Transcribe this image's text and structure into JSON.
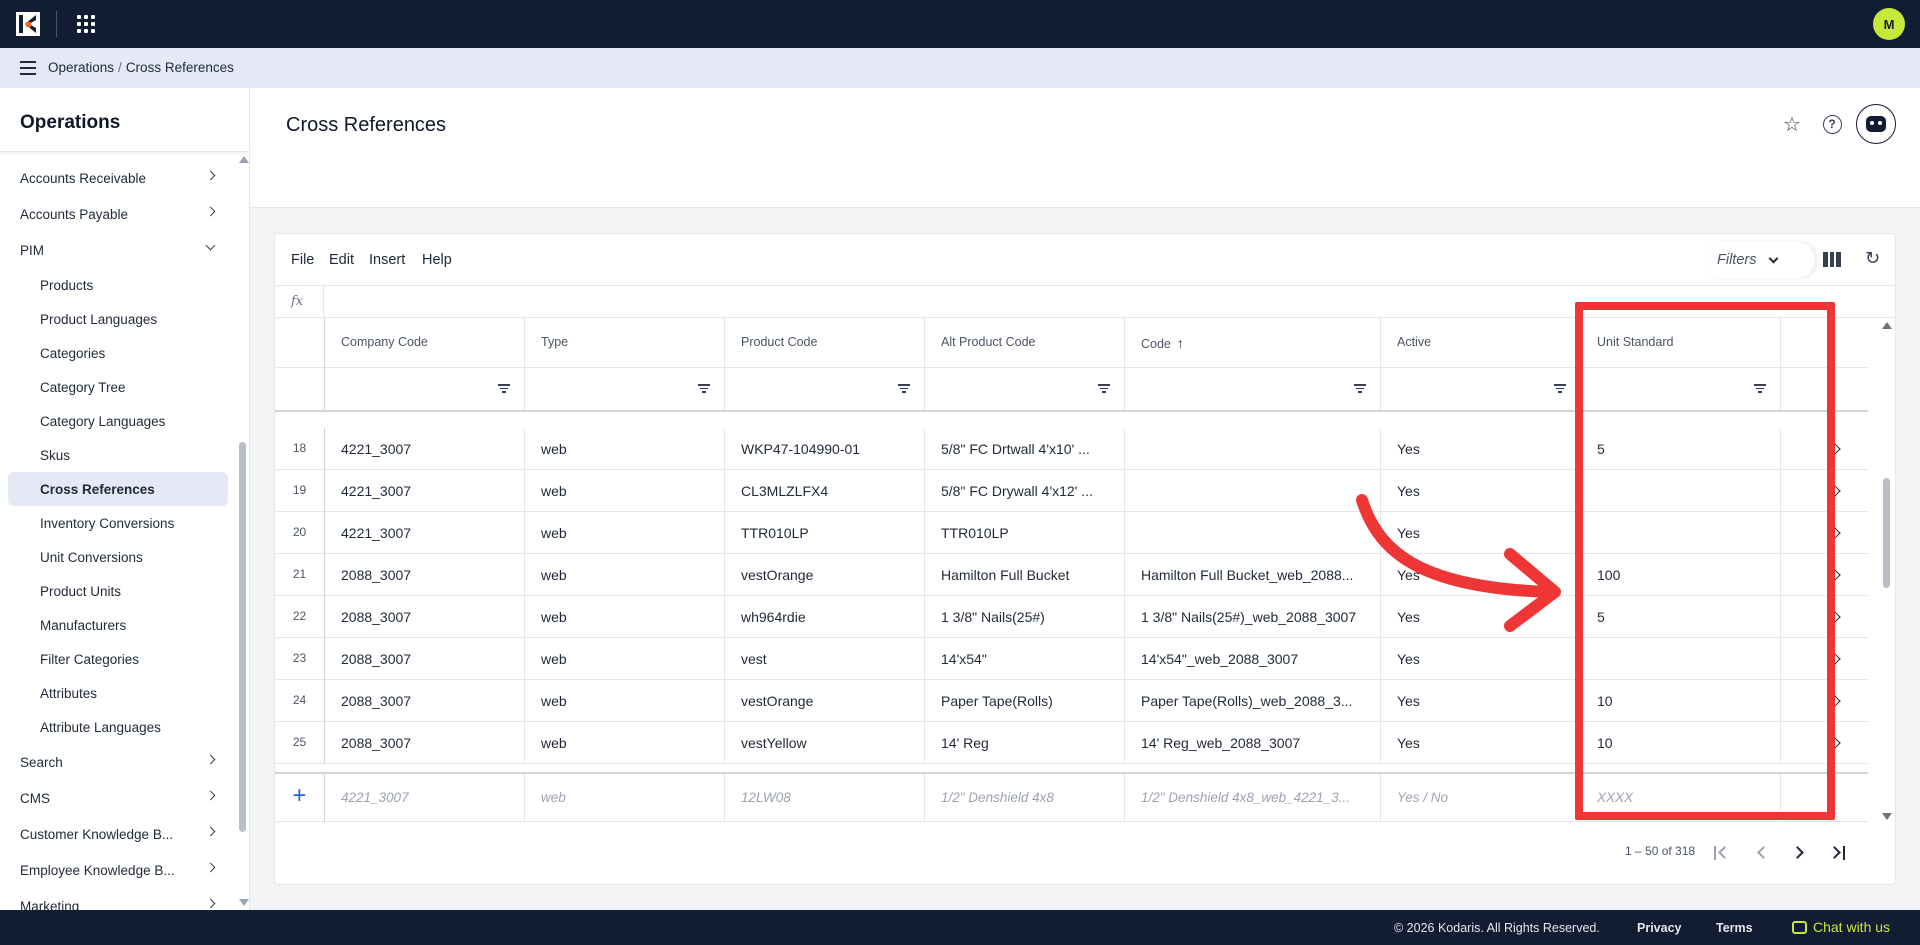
{
  "topbar": {
    "avatar_initial": "M"
  },
  "breadcrumb": {
    "parent": "Operations",
    "separator": "/",
    "current": "Cross References"
  },
  "sidebar": {
    "title": "Operations",
    "top_items": [
      {
        "label": "Accounts Receivable"
      },
      {
        "label": "Accounts Payable"
      },
      {
        "label": "PIM"
      }
    ],
    "pim_items": [
      {
        "label": "Products"
      },
      {
        "label": "Product Languages"
      },
      {
        "label": "Categories"
      },
      {
        "label": "Category Tree"
      },
      {
        "label": "Category Languages"
      },
      {
        "label": "Skus"
      },
      {
        "label": "Cross References"
      },
      {
        "label": "Inventory Conversions"
      },
      {
        "label": "Unit Conversions"
      },
      {
        "label": "Product Units"
      },
      {
        "label": "Manufacturers"
      },
      {
        "label": "Filter Categories"
      },
      {
        "label": "Attributes"
      },
      {
        "label": "Attribute Languages"
      }
    ],
    "bottom_items": [
      {
        "label": "Search"
      },
      {
        "label": "CMS"
      },
      {
        "label": "Customer Knowledge B..."
      },
      {
        "label": "Employee Knowledge B..."
      },
      {
        "label": "Marketing"
      }
    ]
  },
  "page": {
    "title": "Cross References"
  },
  "toolbar": {
    "menus": [
      "File",
      "Edit",
      "Insert",
      "Help"
    ],
    "filters_label": "Filters",
    "fx_label": "fx"
  },
  "table": {
    "columns": [
      "Company Code",
      "Type",
      "Product Code",
      "Alt Product Code",
      "Code",
      "Active",
      "Unit Standard"
    ],
    "sort_arrow": "↑",
    "rows": [
      {
        "n": "18",
        "company": "4221_3007",
        "type": "web",
        "product": "WKP47-104990-01",
        "alt": "5/8\" FC Drtwall 4'x10' ...",
        "code": "",
        "active": "Yes",
        "unit": "5"
      },
      {
        "n": "19",
        "company": "4221_3007",
        "type": "web",
        "product": "CL3MLZLFX4",
        "alt": "5/8\" FC Drywall 4'x12' ...",
        "code": "",
        "active": "Yes",
        "unit": ""
      },
      {
        "n": "20",
        "company": "4221_3007",
        "type": "web",
        "product": "TTR010LP",
        "alt": "TTR010LP",
        "code": "",
        "active": "Yes",
        "unit": ""
      },
      {
        "n": "21",
        "company": "2088_3007",
        "type": "web",
        "product": "vestOrange",
        "alt": "Hamilton Full Bucket",
        "code": "Hamilton Full Bucket_web_2088...",
        "active": "Yes",
        "unit": "100"
      },
      {
        "n": "22",
        "company": "2088_3007",
        "type": "web",
        "product": "wh964rdie",
        "alt": "1 3/8\" Nails(25#)",
        "code": "1 3/8\" Nails(25#)_web_2088_3007",
        "active": "Yes",
        "unit": "5"
      },
      {
        "n": "23",
        "company": "2088_3007",
        "type": "web",
        "product": "vest",
        "alt": "14'x54\"",
        "code": "14'x54\"_web_2088_3007",
        "active": "Yes",
        "unit": ""
      },
      {
        "n": "24",
        "company": "2088_3007",
        "type": "web",
        "product": "vestOrange",
        "alt": "Paper Tape(Rolls)",
        "code": "Paper Tape(Rolls)_web_2088_3...",
        "active": "Yes",
        "unit": "10"
      },
      {
        "n": "25",
        "company": "2088_3007",
        "type": "web",
        "product": "vestYellow",
        "alt": "14' Reg",
        "code": "14' Reg_web_2088_3007",
        "active": "Yes",
        "unit": "10"
      }
    ],
    "new_row_placeholders": {
      "company": "4221_3007",
      "type": "web",
      "product": "12LW08",
      "alt": "1/2\" Denshield 4x8",
      "code": "1/2\" Denshield 4x8_web_4221_3...",
      "active": "Yes / No",
      "unit": "XXXX"
    }
  },
  "pager": {
    "text": "1 – 50 of 318"
  },
  "footer": {
    "copyright": "© 2026 Kodaris. All Rights Reserved.",
    "privacy": "Privacy",
    "terms": "Terms",
    "chat": "Chat with us"
  },
  "annotation": {
    "color": "#ef3636"
  }
}
